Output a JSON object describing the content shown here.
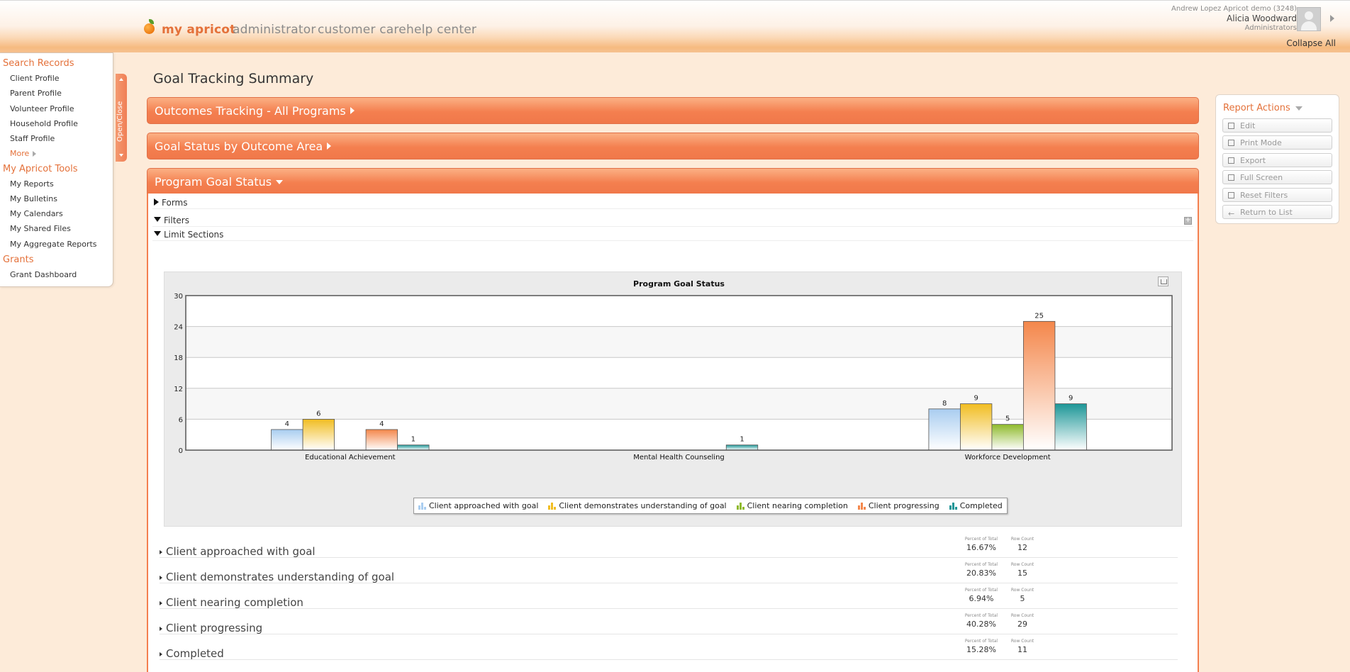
{
  "header": {
    "nav": [
      "my apricot",
      "administrator",
      "customer care",
      "help center"
    ],
    "user_org": "Andrew Lopez Apricot demo (3248)",
    "user_name": "Alicia Woodward",
    "user_role": "Administrators",
    "collapse_all": "Collapse All"
  },
  "sidebar": {
    "sections": [
      {
        "title": "Search Records",
        "items": [
          "Client Profile",
          "Parent Profile",
          "Volunteer Profile",
          "Household Profile",
          "Staff Profile",
          "More"
        ]
      },
      {
        "title": "My Apricot Tools",
        "items": [
          "My Reports",
          "My Bulletins",
          "My Calendars",
          "My Shared Files",
          "My Aggregate Reports"
        ]
      },
      {
        "title": "Grants",
        "items": [
          "Grant Dashboard"
        ]
      }
    ],
    "toggle_label": "Open/Close"
  },
  "main": {
    "page_title": "Goal Tracking Summary",
    "panels": [
      "Outcomes Tracking - All Programs",
      "Goal Status by Outcome Area",
      "Program Goal Status"
    ],
    "tree": [
      "Forms",
      "Filters",
      "Limit Sections"
    ],
    "summary_headers": {
      "percent": "Percent of Total",
      "count": "Row Count"
    },
    "summary": [
      {
        "label": "Client approached with goal",
        "percent": "16.67%",
        "count": "12"
      },
      {
        "label": "Client demonstrates understanding of goal",
        "percent": "20.83%",
        "count": "15"
      },
      {
        "label": "Client nearing completion",
        "percent": "6.94%",
        "count": "5"
      },
      {
        "label": "Client progressing",
        "percent": "40.28%",
        "count": "29"
      },
      {
        "label": "Completed",
        "percent": "15.28%",
        "count": "11"
      }
    ]
  },
  "report_actions": {
    "title": "Report Actions",
    "buttons": [
      "Edit",
      "Print Mode",
      "Export",
      "Full Screen",
      "Reset Filters",
      "Return to List"
    ]
  },
  "colors": {
    "accent": "#e4713a",
    "panel": "#f47f4f"
  },
  "chart_data": {
    "type": "bar",
    "title": "Program Goal Status",
    "categories": [
      "Educational Achievement",
      "Mental Health Counseling",
      "Workforce Development"
    ],
    "ylim": [
      0,
      30
    ],
    "yticks": [
      0,
      6,
      12,
      18,
      24,
      30
    ],
    "legend_position": "bottom",
    "series": [
      {
        "name": "Client approached with goal",
        "color": "#a9cdf0",
        "values": [
          4,
          0,
          8
        ]
      },
      {
        "name": "Client demonstrates understanding of goal",
        "color": "#f1bd21",
        "values": [
          6,
          0,
          9
        ]
      },
      {
        "name": "Client nearing completion",
        "color": "#8fba2c",
        "values": [
          0,
          0,
          5
        ]
      },
      {
        "name": "Client progressing",
        "color": "#f4874b",
        "values": [
          4,
          0,
          25
        ]
      },
      {
        "name": "Completed",
        "color": "#1d9697",
        "values": [
          1,
          1,
          9
        ]
      }
    ]
  }
}
